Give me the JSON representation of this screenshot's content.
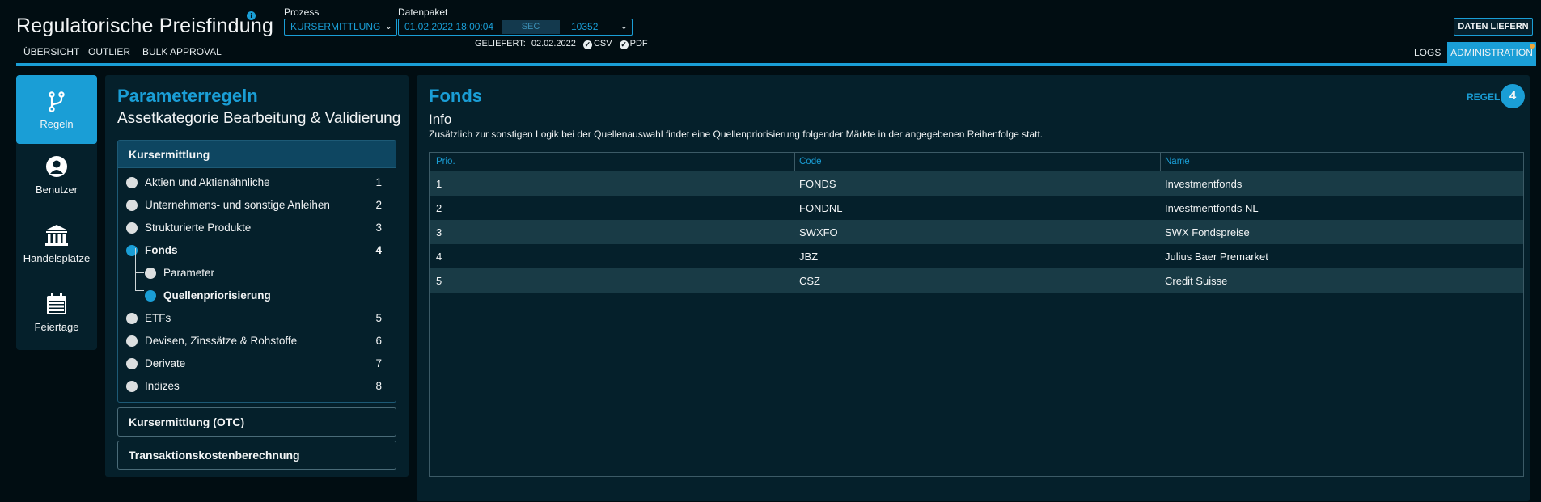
{
  "app": {
    "title": "Regulatorische Preisfindung",
    "info_icon": "info-icon"
  },
  "process": {
    "label": "Prozess",
    "value": "KURSERMITTLUNG"
  },
  "datenpaket": {
    "label": "Datenpaket",
    "datetime": "01.02.2022 18:00:04",
    "badge": "SEC",
    "number": "10352"
  },
  "delivered": {
    "text": "GELIEFERT:",
    "date": "02.02.2022",
    "csv": "CSV",
    "pdf": "PDF"
  },
  "actions": {
    "deliver_label": "DATEN LIEFERN"
  },
  "topnav": {
    "items": [
      "ÜBERSICHT",
      "OUTLIER",
      "BULK APPROVAL"
    ],
    "logs": "LOGS",
    "admin": "ADMINISTRATION"
  },
  "colors": {
    "accent": "#1a9ed6",
    "background": "#010d12",
    "panel": "#05202b",
    "notification": "#f0a83b"
  },
  "sidebar": {
    "items": [
      {
        "label": "Regeln",
        "icon": "branch-icon",
        "active": true
      },
      {
        "label": "Benutzer",
        "icon": "user-icon",
        "active": false
      },
      {
        "label": "Handelsplätze",
        "icon": "bank-icon",
        "active": false
      },
      {
        "label": "Feiertage",
        "icon": "calendar-icon",
        "active": false
      }
    ]
  },
  "rules_panel": {
    "title": "Parameterregeln",
    "subtitle": "Assetkategorie Bearbeitung & Validierung",
    "open_section": {
      "title": "Kursermittlung",
      "items": [
        {
          "label": "Aktien und Aktienähnliche",
          "count": "1"
        },
        {
          "label": "Unternehmens- und sonstige Anleihen",
          "count": "2"
        },
        {
          "label": "Strukturierte Produkte",
          "count": "3"
        },
        {
          "label": "Fonds",
          "count": "4"
        },
        {
          "label": "Parameter"
        },
        {
          "label": "Quellenpriorisierung"
        },
        {
          "label": "ETFs",
          "count": "5"
        },
        {
          "label": "Devisen, Zinssätze & Rohstoffe",
          "count": "6"
        },
        {
          "label": "Derivate",
          "count": "7"
        },
        {
          "label": "Indizes",
          "count": "8"
        }
      ]
    },
    "closed_sections": [
      "Kursermittlung (OTC)",
      "Transaktionskostenberechnung"
    ]
  },
  "main": {
    "title": "Fonds",
    "regel_label": "REGEL",
    "regel_number": "4",
    "info_title": "Info",
    "info_text": "Zusätzlich zur sonstigen Logik bei der Quellenauswahl findet eine Quellenpriorisierung folgender Märkte in der angegebenen Reihenfolge statt.",
    "table": {
      "columns": [
        "Prio.",
        "Code",
        "Name"
      ],
      "rows": [
        [
          "1",
          "FONDS",
          "Investmentfonds"
        ],
        [
          "2",
          "FONDNL",
          "Investmentfonds NL"
        ],
        [
          "3",
          "SWXFO",
          "SWX Fondspreise"
        ],
        [
          "4",
          "JBZ",
          "Julius Baer Premarket"
        ],
        [
          "5",
          "CSZ",
          "Credit Suisse"
        ]
      ]
    }
  }
}
